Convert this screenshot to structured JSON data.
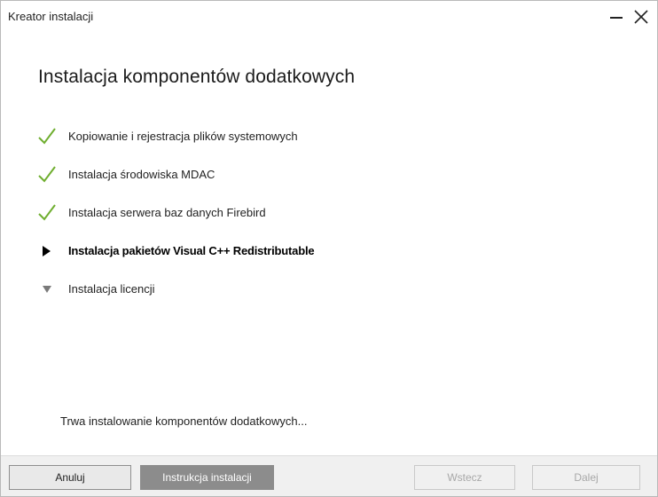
{
  "window": {
    "title": "Kreator instalacji"
  },
  "heading": "Instalacja komponentów dodatkowych",
  "steps": [
    {
      "label": "Kopiowanie i rejestracja plików systemowych",
      "state": "done",
      "icon": "checkmark-icon"
    },
    {
      "label": "Instalacja środowiska MDAC",
      "state": "done",
      "icon": "checkmark-icon"
    },
    {
      "label": "Instalacja serwera baz danych Firebird",
      "state": "done",
      "icon": "checkmark-icon"
    },
    {
      "label": "Instalacja pakietów Visual C++ Redistributable",
      "state": "in-progress",
      "icon": "play-arrow-icon"
    },
    {
      "label": "Instalacja licencji",
      "state": "pending",
      "icon": "triangle-down-icon"
    }
  ],
  "status_text": "Trwa instalowanie komponentów dodatkowych...",
  "footer": {
    "cancel_label": "Anuluj",
    "guide_label": "Instrukcja instalacji",
    "back_label": "Wstecz",
    "next_label": "Dalej"
  },
  "colors": {
    "check": "#6fae2f",
    "active_arrow": "#000000",
    "pending_arrow": "#7a7a7a",
    "guide_button_bg": "#8c8c8c",
    "footer_bg": "#f0f0f0"
  }
}
